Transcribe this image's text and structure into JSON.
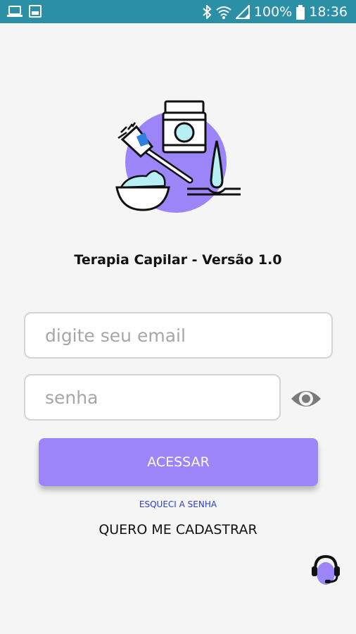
{
  "status_bar": {
    "battery": "100%",
    "time": "18:36",
    "icons": [
      "laptop-icon",
      "image-icon",
      "bluetooth-icon",
      "wifi-icon",
      "signal-icon",
      "battery-icon"
    ]
  },
  "app": {
    "title": "Terapia Capilar - Versão 1.0",
    "logo": "hair-therapy-logo"
  },
  "form": {
    "email_placeholder": "digite seu email",
    "password_placeholder": "senha",
    "email_value": "",
    "password_value": ""
  },
  "actions": {
    "login_label": "ACESSAR",
    "forgot_label": "ESQUECI A SENHA",
    "register_label": "QUERO ME CADASTRAR"
  },
  "colors": {
    "status_bar": "#2b8fa6",
    "accent": "#9b85f8",
    "link": "#2b3ccf",
    "background": "#f5f5f5"
  }
}
